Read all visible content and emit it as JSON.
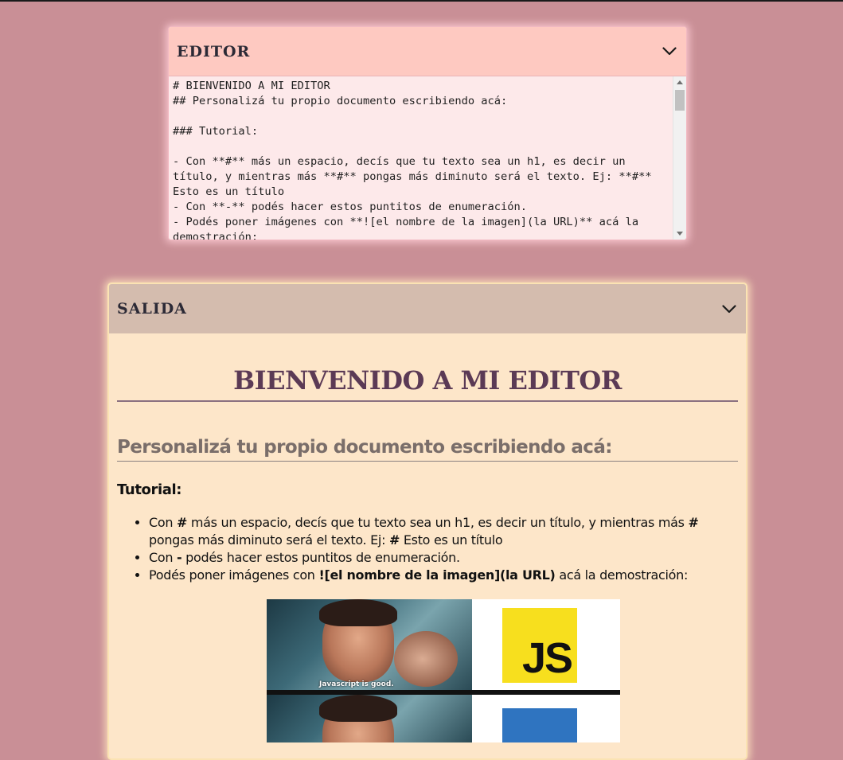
{
  "editor": {
    "title": "EDITOR",
    "content": "# BIENVENIDO A MI EDITOR\n## Personalizá tu propio documento escribiendo acá:\n\n### Tutorial:\n\n- Con **#** más un espacio, decís que tu texto sea un h1, es decir un título, y mientras más **#** pongas más diminuto será el texto. Ej: **#** Esto es un título\n- Con **-** podés hacer estos puntitos de enumeración.\n- Podés poner imágenes con **![el nombre de la imagen](la URL)** acá la demostración:"
  },
  "output": {
    "title": "SALIDA",
    "h1": "BIENVENIDO A MI EDITOR",
    "h2": "Personalizá tu propio documento escribiendo acá:",
    "h3": "Tutorial:",
    "list": [
      {
        "pre": "Con ",
        "bold": "#",
        "mid": " más un espacio, decís que tu texto sea un h1, es decir un título, y mientras más ",
        "bold2": "#",
        "mid2": " pongas más diminuto será el texto. Ej: ",
        "bold3": "#",
        "post": " Esto es un título"
      },
      {
        "pre": "Con ",
        "bold": "-",
        "post": " podés hacer estos puntitos de enumeración."
      },
      {
        "pre": "Podés poner imágenes con ",
        "bold": "![el nombre de la imagen](la URL)",
        "post": " acá la demostración:"
      }
    ],
    "image": {
      "caption": "Javascript is good.",
      "logo_text": "JS"
    }
  },
  "colors": {
    "page_bg": "#c98f96",
    "editor_header": "#fec9c1",
    "editor_body": "#fde9ea",
    "output_header": "#d4bcae",
    "output_body": "#fde6c9",
    "h1_color": "#5b3a55",
    "js_yellow": "#f7df1e",
    "ts_blue": "#2f74c0"
  },
  "icons": {
    "editor_toggle": "chevron-down-icon",
    "output_toggle": "chevron-down-icon"
  }
}
